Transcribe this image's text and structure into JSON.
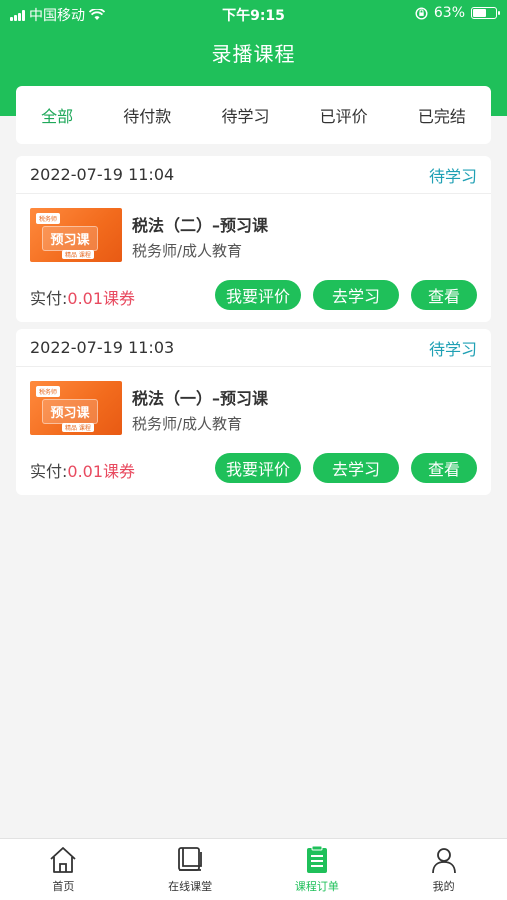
{
  "status_bar": {
    "carrier": "中国移动",
    "time": "下午9:15",
    "battery": "63%",
    "battery_level": 0.63
  },
  "header": {
    "title": "录播课程"
  },
  "tabs": [
    {
      "label": "全部",
      "active": true
    },
    {
      "label": "待付款",
      "active": false
    },
    {
      "label": "待学习",
      "active": false
    },
    {
      "label": "已评价",
      "active": false
    },
    {
      "label": "已完结",
      "active": false
    }
  ],
  "orders": [
    {
      "datetime": "2022-07-19 11:04",
      "status": "待学习",
      "thumb": {
        "tag": "税务师",
        "main": "预习课",
        "sub": "精品 课程"
      },
      "course_name": "税法（二）–预习课",
      "category": "税务师/成人教育",
      "price_label": "实付:",
      "price_value": "0.01课券",
      "buttons": {
        "review": "我要评价",
        "study": "去学习",
        "view": "查看"
      }
    },
    {
      "datetime": "2022-07-19 11:03",
      "status": "待学习",
      "thumb": {
        "tag": "税务师",
        "main": "预习课",
        "sub": "精品 课程"
      },
      "course_name": "税法（一）–预习课",
      "category": "税务师/成人教育",
      "price_label": "实付:",
      "price_value": "0.01课券",
      "buttons": {
        "review": "我要评价",
        "study": "去学习",
        "view": "查看"
      }
    }
  ],
  "bottom_nav": [
    {
      "label": "首页",
      "icon": "home-icon",
      "active": false
    },
    {
      "label": "在线课堂",
      "icon": "book-icon",
      "active": false
    },
    {
      "label": "课程订单",
      "icon": "order-list-icon",
      "active": true
    },
    {
      "label": "我的",
      "icon": "user-icon",
      "active": false
    }
  ],
  "colors": {
    "brand_green": "#1fc05a",
    "status_teal": "#1fa0b4",
    "price_red": "#e84a5f"
  }
}
